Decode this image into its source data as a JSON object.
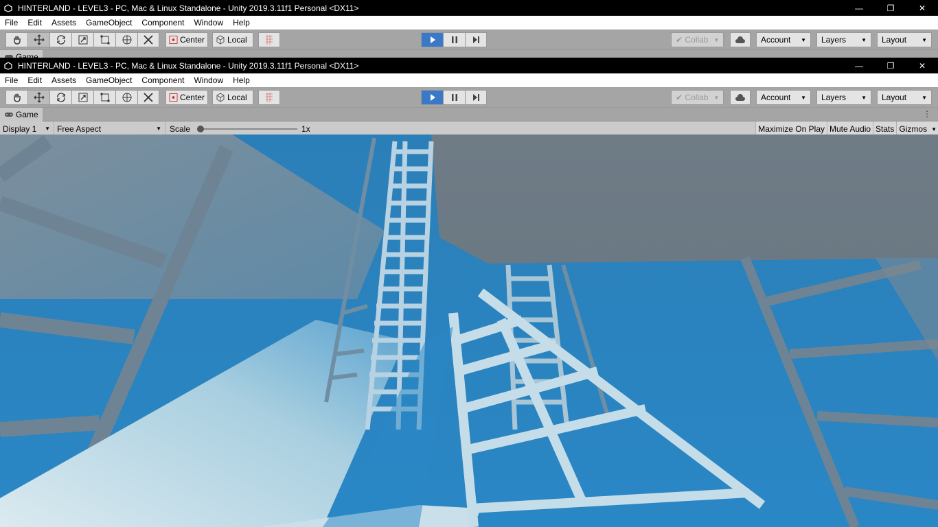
{
  "window_title": "HINTERLAND - LEVEL3 - PC, Mac & Linux Standalone - Unity 2019.3.11f1 Personal <DX11>",
  "window_controls": {
    "minimize": "—",
    "restore": "❐",
    "close": "✕"
  },
  "menu": [
    "File",
    "Edit",
    "Assets",
    "GameObject",
    "Component",
    "Window",
    "Help"
  ],
  "toolbar": {
    "tools": [
      "hand-tool",
      "move-tool",
      "rotate-tool",
      "scale-tool",
      "rect-tool",
      "transform-tool",
      "custom-tool"
    ],
    "pivot_mode": "Center",
    "pivot_rotation": "Local",
    "collab": "Collab",
    "account": "Account",
    "layers": "Layers",
    "layout": "Layout"
  },
  "game_tab": {
    "label": "Game",
    "menu": "⋮"
  },
  "game_bar": {
    "display": "Display 1",
    "aspect": "Free Aspect",
    "scale_label": "Scale",
    "scale_value": "1x",
    "maximize_on_play": "Maximize On Play",
    "mute_audio": "Mute Audio",
    "stats": "Stats",
    "gizmos": "Gizmos"
  },
  "colors": {
    "sky": "#2a83bf",
    "toolbar": "#a5a5a5",
    "play_active": "#3a79c8",
    "structure": "#6e8494"
  }
}
